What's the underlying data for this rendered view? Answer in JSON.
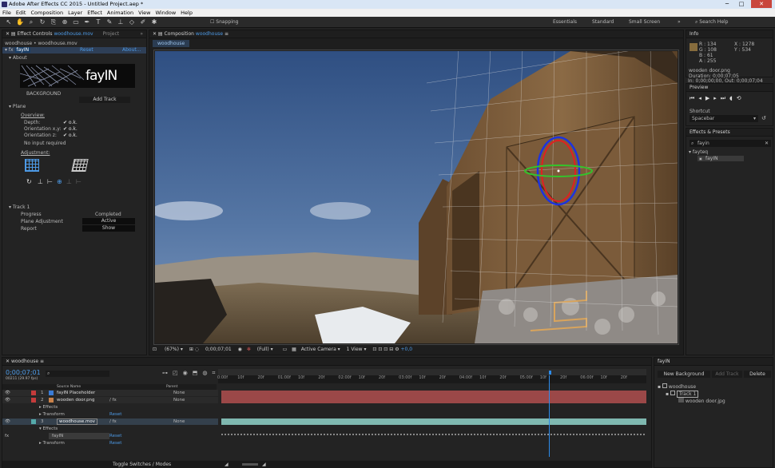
{
  "window": {
    "title": "Adobe After Effects CC 2015 - Untitled Project.aep *",
    "min": "─",
    "max": "□",
    "close": "✕"
  },
  "menu": [
    "File",
    "Edit",
    "Composition",
    "Layer",
    "Effect",
    "Animation",
    "View",
    "Window",
    "Help"
  ],
  "toolbar": {
    "snapping": "Snapping",
    "workspaces": [
      "Essentials",
      "Standard",
      "Small Screen"
    ],
    "search": "Search Help"
  },
  "effect_controls": {
    "tab": "Effect Controls",
    "tab_file": "woodhouse.mov",
    "tab2": "Project",
    "path": "woodhouse • woodhouse.mov",
    "fx_name": "fayIN",
    "reset": "Reset",
    "about": "About...",
    "about_section": "About",
    "logo_text": "fayIN",
    "background_label": "BACKGROUND",
    "add_track": "Add Track",
    "plane_section": "Plane",
    "overview_label": "Overview:",
    "depth_label": "Depth:",
    "orientation_xy_label": "Orientation x,y:",
    "orientation_z_label": "Orientation z:",
    "ok": "✔ o.k.",
    "no_input": "No input required",
    "adjustment_label": "Adjustment:",
    "track_section": "Track 1",
    "progress_label": "Progress",
    "progress_value": "Completed",
    "plane_adj_label": "Plane Adjustment",
    "plane_adj_value": "Active",
    "report_label": "Report",
    "report_value": "Show"
  },
  "composition": {
    "tab": "Composition",
    "tab_name": "woodhouse",
    "subtab": "woodhouse",
    "zoom": "(67%)",
    "timecode": "0;00;07;01",
    "resolution": "(Full)",
    "camera": "Active Camera",
    "view": "1 View",
    "exposure": "+0,0"
  },
  "info": {
    "title": "Info",
    "r": "R : 134",
    "g": "G : 108",
    "b": "B : 61",
    "a": "A : 255",
    "x": "X : 1278",
    "y": "Y : 534",
    "file": "wooden door.png",
    "duration": "Duration: 0;00;07;05",
    "in": "In: 0;00;00;00, Out: 0;00;07;04"
  },
  "preview": {
    "title": "Preview",
    "shortcut_label": "Shortcut",
    "shortcut_value": "Spacebar"
  },
  "effects_presets": {
    "title": "Effects & Presets",
    "search": "fayin",
    "category": "fayteq",
    "item": "fayIN"
  },
  "timeline": {
    "tab": "woodhouse",
    "timecode": "0;00;07;01",
    "fps": "00211 (29.97 fps)",
    "col_source": "Source Name",
    "col_parent": "Parent",
    "ticks": [
      "0:00f",
      "10f",
      "20f",
      "01:00f",
      "10f",
      "20f",
      "02:00f",
      "10f",
      "20f",
      "03:00f",
      "10f",
      "20f",
      "04:00f",
      "10f",
      "20f",
      "05:00f",
      "10f",
      "20f",
      "06:00f",
      "10f",
      "20f"
    ],
    "layers": [
      {
        "num": "1",
        "name": "fayIN Placeholder",
        "parent": "None",
        "color": "#3a7bd5"
      },
      {
        "num": "2",
        "name": "wooden door.png",
        "parent": "None",
        "color": "#c43b3b"
      },
      {
        "num": "3",
        "name": "woodhouse.mov",
        "parent": "None",
        "color": "#5aa"
      }
    ],
    "effects_label": "Effects",
    "transform_label": "Transform",
    "reset": "Reset",
    "fx_item": "fayIN",
    "toggle": "Toggle Switches / Modes"
  },
  "fayin_panel": {
    "title": "fayIN",
    "new_bg": "New Background",
    "add_track": "Add Track",
    "delete": "Delete",
    "tree_root": "woodhouse",
    "tree_track": "Track 1",
    "tree_file": "wooden door.jpg"
  },
  "colors": {
    "bar_red": "#9b4848",
    "bar_teal": "#7fb8b0",
    "accent": "#2d8ceb"
  }
}
